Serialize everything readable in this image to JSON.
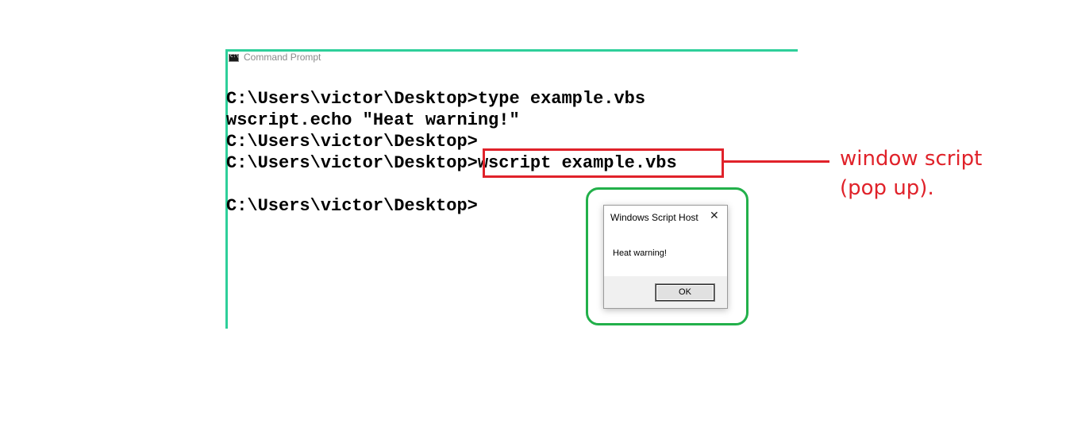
{
  "cmd_window": {
    "title": "Command Prompt",
    "icon": "console-icon"
  },
  "console": {
    "lines": [
      "C:\\Users\\victor\\Desktop>type example.vbs",
      "wscript.echo \"Heat warning!\"",
      "C:\\Users\\victor\\Desktop>",
      "C:\\Users\\victor\\Desktop>wscript example.vbs",
      "",
      "C:\\Users\\victor\\Desktop>"
    ]
  },
  "annotation": {
    "line1": "window script",
    "line2": "(pop up).",
    "color": "#e0222a"
  },
  "dialog": {
    "title": "Windows Script Host",
    "close_symbol": "✕",
    "message": "Heat warning!",
    "ok_label": "OK"
  },
  "colors": {
    "cmd_border": "#2ecf9a",
    "highlight_red": "#e0222a",
    "highlight_green": "#22b04a"
  }
}
